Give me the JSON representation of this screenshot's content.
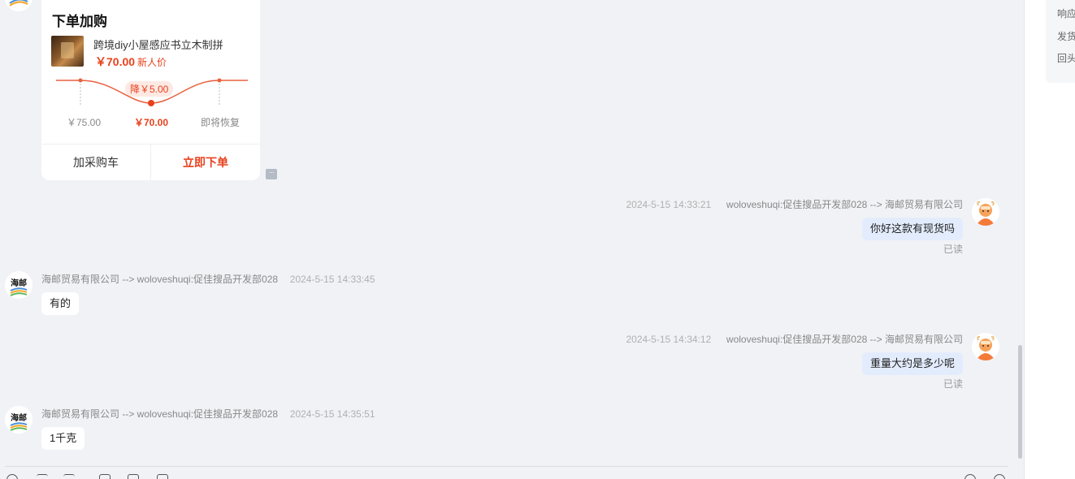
{
  "product_card": {
    "title": "下单加购",
    "product_name": "跨境diy小屋感应书立木制拼",
    "price": "￥70.00",
    "price_tag": "新人价",
    "drop_badge": "降￥5.00",
    "price_labels": [
      "￥75.00",
      "￥70.00",
      "即将恢复"
    ],
    "add_cart_label": "加采购车",
    "buy_now_label": "立即下单"
  },
  "messages": [
    {
      "side": "out",
      "time": "2024-5-15 14:33:21",
      "sender": "woloveshuqi:促佳搜品开发部028 --> 海邮贸易有限公司",
      "text": "你好这款有现货吗",
      "status": "已读"
    },
    {
      "side": "in",
      "sender": "海邮贸易有限公司 --> woloveshuqi:促佳搜品开发部028",
      "time": "2024-5-15 14:33:45",
      "text": "有的"
    },
    {
      "side": "out",
      "time": "2024-5-15 14:34:12",
      "sender": "woloveshuqi:促佳搜品开发部028 --> 海邮贸易有限公司",
      "text": "重量大约是多少呢",
      "status": "已读"
    },
    {
      "side": "in",
      "sender": "海邮贸易有限公司 --> woloveshuqi:促佳搜品开发部028",
      "time": "2024-5-15 14:35:51",
      "text": "1千克"
    }
  ],
  "shop_avatar_text": "海邮",
  "right_panel": {
    "items": [
      "响应",
      "发货",
      "回头"
    ]
  },
  "colors": {
    "accent": "#e8411d",
    "out_bubble": "#e3ecfd",
    "background": "#f1f2f6"
  }
}
